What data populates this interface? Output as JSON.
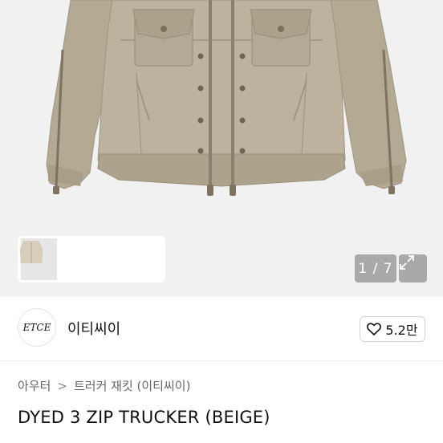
{
  "gallery": {
    "counter": "1 / 7",
    "thumbnails": [
      {
        "name": "thumb-dark-jacket",
        "selected": true
      },
      {
        "name": "thumb-beige-jacket",
        "selected": false
      },
      {
        "name": "thumb-light-jacket",
        "selected": false
      }
    ]
  },
  "brand": {
    "logo_text": "ETCE",
    "name": "이티씨이"
  },
  "like": {
    "count": "5.2만",
    "icon": "heart-icon"
  },
  "breadcrumb": {
    "items": [
      "아우터",
      "트러커 재킷 (이티씨이)"
    ],
    "separator": ">"
  },
  "product": {
    "title": "DYED 3 ZIP TRUCKER (BEIGE)"
  },
  "colors": {
    "jacket": "#b7ad98",
    "background": "#f1f1f1"
  }
}
